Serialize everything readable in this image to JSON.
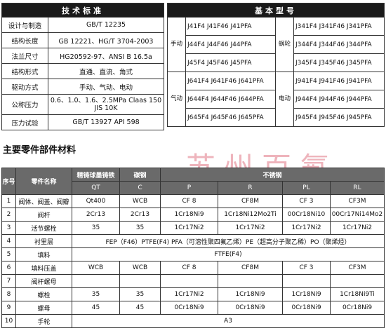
{
  "standards": {
    "title": "技术标准",
    "rows": [
      {
        "label": "设计与制造",
        "value": "GB/T 12235"
      },
      {
        "label": "结构长度",
        "value": "GB 12221、HG/T 3704-2003"
      },
      {
        "label": "法兰尺寸",
        "value": "HG20592-97、ANSI B 16.5a"
      },
      {
        "label": "结构形式",
        "value": "直通、直流、角式"
      },
      {
        "label": "驱动方式",
        "value": "手动、气动、电动"
      },
      {
        "label": "公称压力",
        "value": "0.6、1.0、1.6、2.5MPa Claas 150  JIS 10K"
      },
      {
        "label": "压力试验",
        "value": "GB/T 13927 API 598"
      }
    ]
  },
  "models": {
    "title": "基本型号",
    "manual_label": "手动",
    "pneumatic_label": "气动",
    "worm_label": "蜗轮",
    "electric_label": "电动",
    "manual": [
      "J41F4 J41F46 J41PFA",
      "J44F4 J44F46 J44PFA",
      "J45F4 J45F46 J45PFA"
    ],
    "pneumatic": [
      "J641F4 J641F46 J641PFA",
      "J644F4 J644F46 J644PFA",
      "J645F4 J645F46 J645PFA"
    ],
    "worm": [
      "J341F4 J341F46 J341PFA",
      "J344F4 J344F46 J344PFA",
      "J345F4 J345F46 J345PFA"
    ],
    "electric": [
      "J941F4 J941F46 J941PFA",
      "J944F4 J944F46 J944PFA",
      "J945F4 J945F46 J945PFA"
    ]
  },
  "materials": {
    "section_title": "主要零件部件材料",
    "watermark": "苏州百氟",
    "header": {
      "no": "序号",
      "part": "零件名称",
      "cast_iron": "精铸球墨铸铁",
      "carbon_steel": "碳钢",
      "stainless": "不锈钢",
      "codes": [
        "QT",
        "C",
        "P",
        "R",
        "PL",
        "RL"
      ]
    },
    "rows": [
      {
        "no": "1",
        "name": "阀体、阀盖、阀瓣",
        "cells": [
          "Qt400",
          "WCB",
          "CF 8",
          "CF8M",
          "CF 3",
          "CF3M"
        ]
      },
      {
        "no": "2",
        "name": "阀杆",
        "cells": [
          "2Cr13",
          "2Cr13",
          "1Cr18Ni9",
          "1Cr18Ni12Mo2Ti",
          "00Cr18Ni10",
          "00Cr17Ni14Mo2"
        ]
      },
      {
        "no": "3",
        "name": "活节螺栓",
        "cells": [
          "35",
          "35",
          "1Cr17Ni2",
          "1Cr17Ni2",
          "1Cr17Ni2",
          "1Cr17Ni2"
        ]
      },
      {
        "no": "4",
        "name": "衬里层",
        "span": "FEP（F46）PTFE(F4) PFA（可溶性聚四氟乙烯）PE（超高分子聚乙稀）PO（聚烯烃）"
      },
      {
        "no": "5",
        "name": "填料",
        "span": "FTFE(F4)"
      },
      {
        "no": "6",
        "name": "填料压盖",
        "cells": [
          "WCB",
          "WCB",
          "CF 8",
          "CF8M",
          "CF 3",
          "CF3M"
        ]
      },
      {
        "no": "7",
        "name": "阀杆螺母",
        "cells": [
          "",
          "",
          "",
          "",
          "",
          ""
        ]
      },
      {
        "no": "8",
        "name": "螺栓",
        "cells": [
          "35",
          "35",
          "1Cr17Ni2",
          "1Cr18Ni9",
          "1Cr18Ni9",
          "1Cr18Ni9Ti"
        ]
      },
      {
        "no": "9",
        "name": "螺母",
        "cells": [
          "45",
          "45",
          "0Cr18Ni9",
          "0Cr18Ni9",
          "0Cr18Ni9",
          "0Cr18Ni9"
        ]
      },
      {
        "no": "10",
        "name": "手轮",
        "span": "A3"
      }
    ]
  }
}
